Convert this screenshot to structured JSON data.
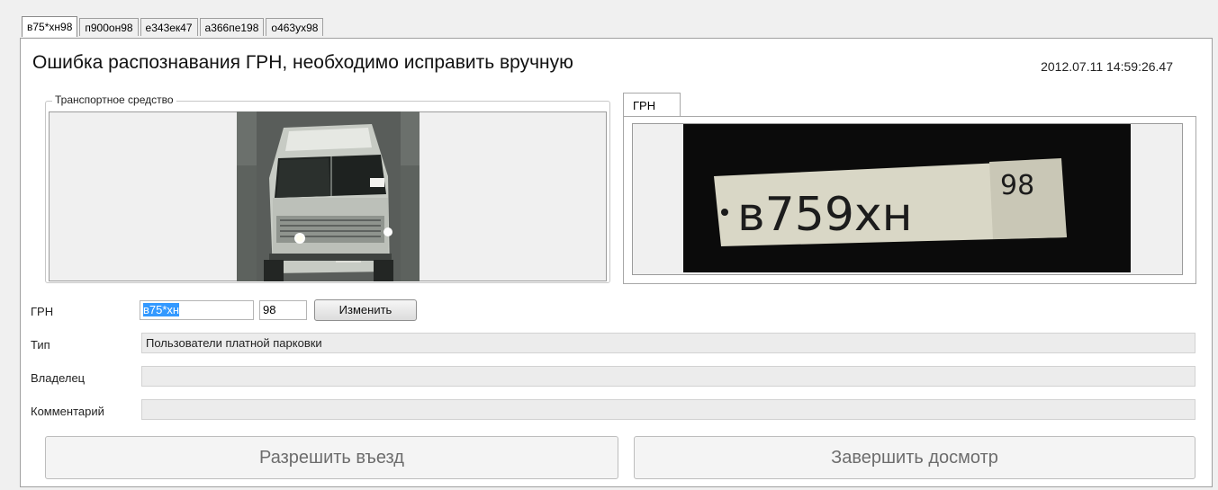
{
  "tabs": [
    "в75*хн98",
    "п900он98",
    "е343ек47",
    "а366пе198",
    "о463ух98"
  ],
  "header": {
    "title": "Ошибка распознавания ГРН, необходимо исправить вручную",
    "timestamp": "2012.07.11 14:59:26.47"
  },
  "vehicle_group": {
    "legend": "Транспортное средство"
  },
  "plate_panel": {
    "tab_label": "ГРН",
    "plate_text": "в759хн",
    "plate_region": "98"
  },
  "form": {
    "plate_label": "ГРН",
    "plate_value": "в75*хн",
    "region_value": "98",
    "change_button": "Изменить",
    "type_label": "Тип",
    "type_value": "Пользователи платной парковки",
    "owner_label": "Владелец",
    "owner_value": "",
    "comment_label": "Комментарий",
    "comment_value": ""
  },
  "actions": {
    "allow_entry": "Разрешить въезд",
    "finish_inspection": "Завершить досмотр"
  }
}
